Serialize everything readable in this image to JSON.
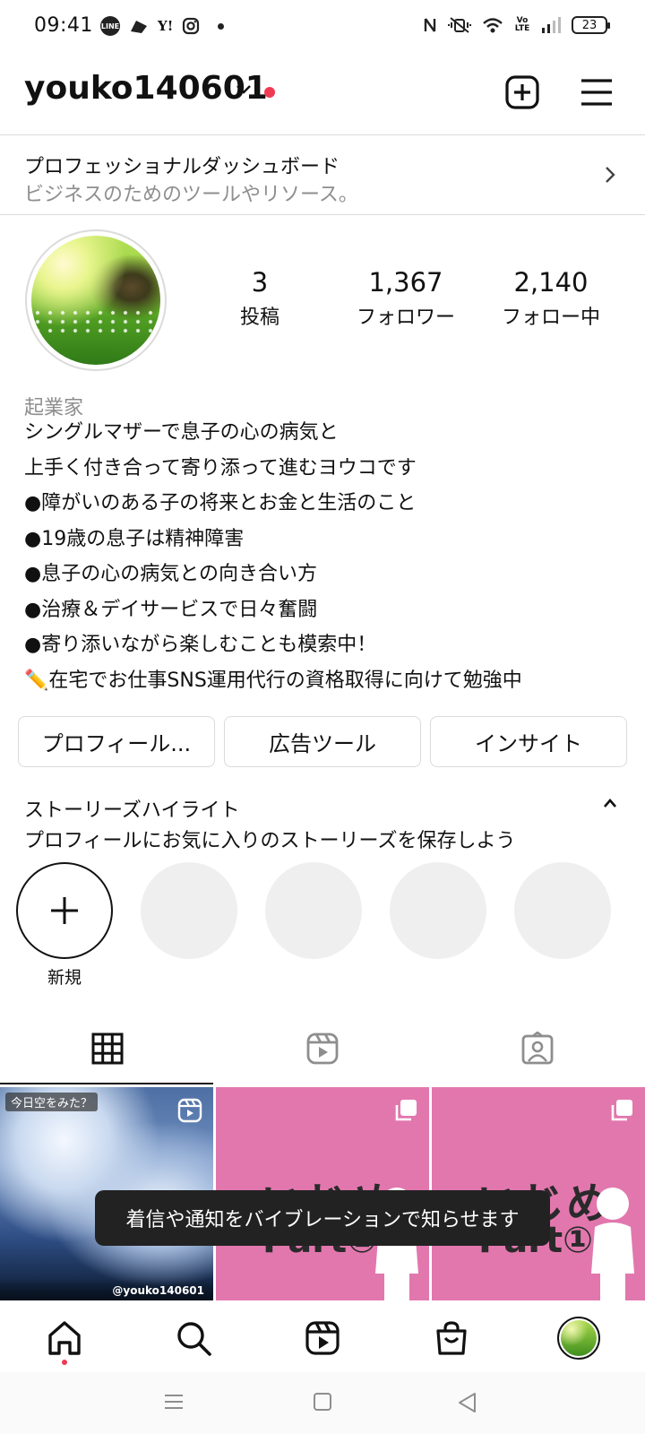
{
  "status_bar": {
    "time": "09:41",
    "notification_icons": [
      "line-icon",
      "drive-icon",
      "yahoo-icon",
      "instagram-icon",
      "dot-icon"
    ],
    "line_label": "LINE",
    "yahoo_label": "Y!",
    "volte_label": "Vo LTE",
    "battery_level": "23"
  },
  "header": {
    "username": "youko140601",
    "has_notification_dot": true,
    "accent_color": "#ef3a55"
  },
  "dashboard": {
    "title": "プロフェッショナルダッシュボード",
    "subtitle": "ビジネスのためのツールやリソース。"
  },
  "stats": {
    "posts": {
      "value": "3",
      "label": "投稿"
    },
    "followers": {
      "value": "1,367",
      "label": "フォロワー"
    },
    "following": {
      "value": "2,140",
      "label": "フォロー中"
    }
  },
  "bio": {
    "category": "起業家",
    "lines": [
      "シングルマザーで息子の心の病気と",
      "上手く付き合って寄り添って進むヨウコです",
      "●障がいのある子の将来とお金と生活のこと",
      "●19歳の息子は精神障害",
      "●息子の心の病気との向き合い方",
      "●治療＆デイサービスで日々奮闘",
      "●寄り添いながら楽しむことも模索中！",
      "✏️在宅でお仕事SNS運用代行の資格取得に向けて勉強中"
    ]
  },
  "buttons": {
    "profile": "プロフィール...",
    "ads": "広告ツール",
    "insights": "インサイト"
  },
  "highlights": {
    "title": "ストーリーズハイライト",
    "subtitle": "プロフィールにお気に入りのストーリーズを保存しよう",
    "new_label": "新規",
    "empty_count": 4
  },
  "tabs": [
    "grid-icon",
    "reels-icon",
    "tagged-icon"
  ],
  "grid": {
    "post1": {
      "caption": "今日空をみた？",
      "watermark": "@youko140601"
    },
    "post2": {
      "title": "いじめ",
      "part": "Part②"
    },
    "post3": {
      "title": "いじめ",
      "part": "Part①"
    }
  },
  "toast": "着信や通知をバイブレーションで知らせます",
  "bottom_nav": [
    "home-icon",
    "search-icon",
    "reels-icon",
    "shop-icon",
    "profile-avatar"
  ],
  "system_nav": [
    "recents-icon",
    "home-square-icon",
    "back-icon"
  ]
}
